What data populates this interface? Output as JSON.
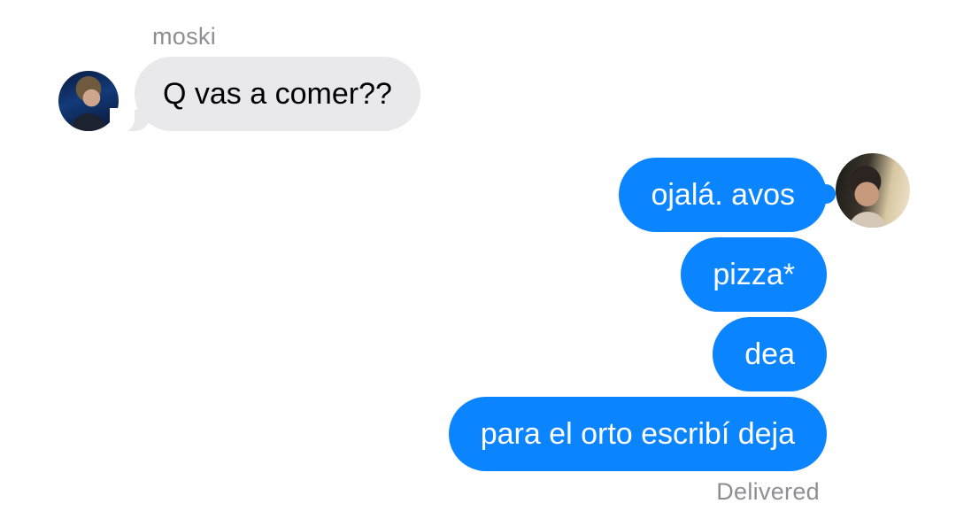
{
  "conversation": {
    "incoming": {
      "sender_name": "moski",
      "avatar_icon": "contact-avatar-photo",
      "messages": [
        "Q vas a comer??"
      ]
    },
    "outgoing": {
      "avatar_icon": "own-avatar-photo",
      "messages": [
        "ojalá. avos",
        "pizza*",
        "dea",
        "para el orto escribí deja"
      ],
      "status": "Delivered"
    }
  },
  "colors": {
    "incoming_bubble": "#e9e9eb",
    "outgoing_bubble": "#0a84ff",
    "meta_text": "#8e8e93"
  }
}
